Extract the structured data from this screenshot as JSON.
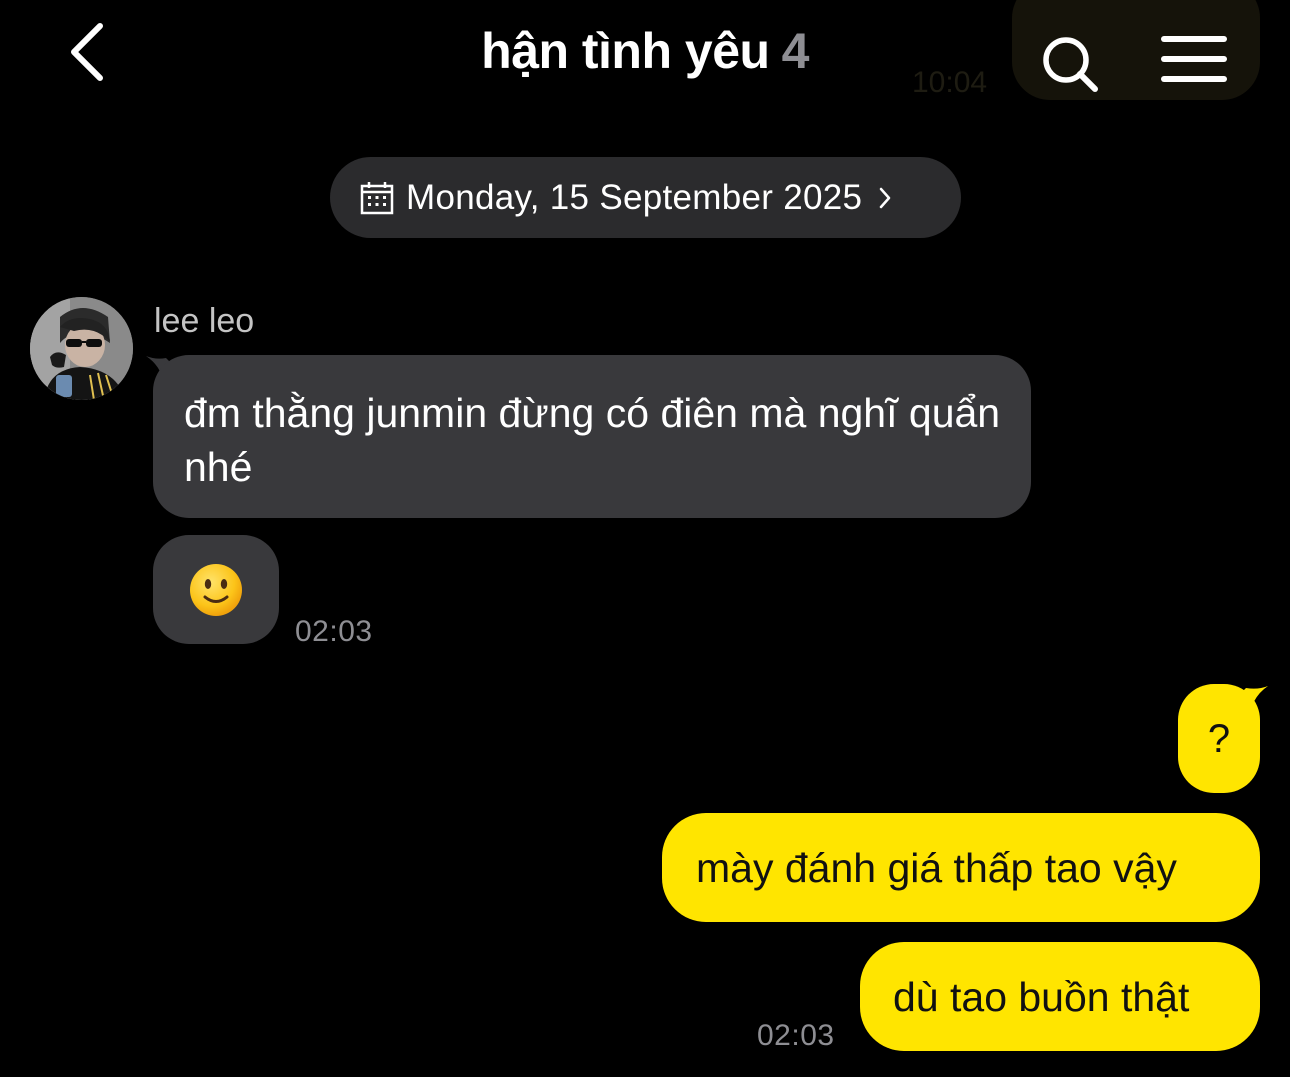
{
  "header": {
    "title": "hận tình yêu",
    "member_count": "4",
    "ghost_time": "10:04",
    "back_icon": "chevron-left-icon",
    "search_icon": "search-icon",
    "menu_icon": "hamburger-menu-icon"
  },
  "date_divider": {
    "icon": "calendar-icon",
    "label": "Monday, 15 September 2025",
    "chevron": "chevron-right-icon"
  },
  "incoming": {
    "sender_name": "lee leo",
    "avatar": "avatar-photo",
    "messages": [
      {
        "text": "đm thằng junmin đừng có điên mà nghĩ quẩn nhé"
      },
      {
        "text": "",
        "emoji": "slightly-smiling-face-emoji"
      }
    ],
    "time": "02:03"
  },
  "outgoing": {
    "messages": [
      {
        "text": "?"
      },
      {
        "text": "mày đánh giá thấp tao vậy"
      },
      {
        "text": "dù tao buồn thật"
      }
    ],
    "time": "02:03"
  },
  "colors": {
    "background": "#000000",
    "incoming_bubble": "#39393c",
    "outgoing_bubble": "#ffe500",
    "date_pill": "#2b2b2d",
    "muted_text": "#8e8e93"
  }
}
